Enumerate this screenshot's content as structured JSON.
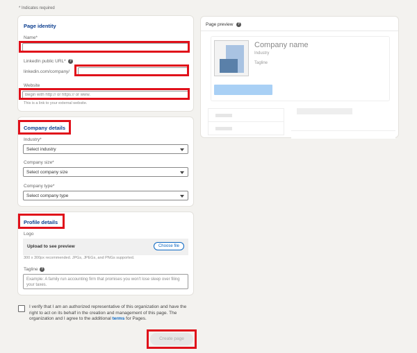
{
  "required_note": "* Indicates required",
  "identity": {
    "title": "Page identity",
    "name_label": "Name*",
    "name_value": "",
    "url_label": "LinkedIn public URL*",
    "url_prefix": "linkedin.com/company/",
    "url_value": "",
    "website_label": "Website",
    "website_placeholder": "Begin with http:// or https:// or www.",
    "website_hint": "This is a link to your external website."
  },
  "company": {
    "title": "Company details",
    "industry_label": "Industry*",
    "industry_value": "Select industry",
    "size_label": "Company size*",
    "size_value": "Select company size",
    "type_label": "Company type*",
    "type_value": "Select company type"
  },
  "profile": {
    "title": "Profile details",
    "logo_label": "Logo",
    "upload_label": "Upload to see preview",
    "choose_file": "Choose file",
    "logo_hint": "300 x 300px recommended. JPGs, JPEGs, and PNGs supported.",
    "tagline_label": "Tagline",
    "tagline_placeholder": "Example: A family run accounting firm that promises you won't lose sleep over filing your taxes."
  },
  "verify": {
    "text_before": "I verify that I am an authorized representative of this organization and have the right to act on its behalf in the creation and management of this page. The organization and I agree to the additional ",
    "terms": "terms",
    "text_after": " for Pages."
  },
  "create_button": "Create page",
  "preview": {
    "header": "Page preview",
    "company_name": "Company name",
    "industry": "Industry",
    "tagline": "Tagline"
  },
  "colors": {
    "highlight": "#e0101a",
    "link": "#0a66c2",
    "section_title": "#0a3d8f"
  }
}
